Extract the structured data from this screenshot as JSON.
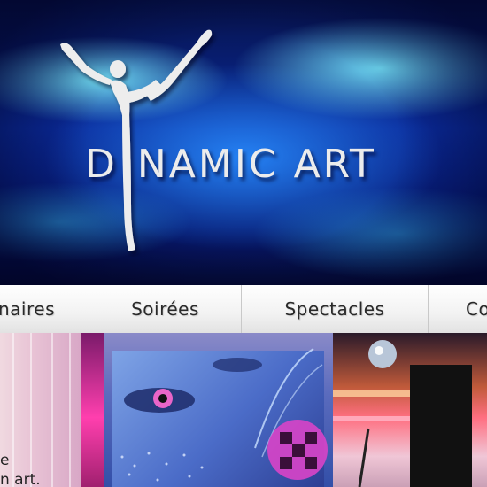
{
  "hero": {
    "logo_text_left": "D",
    "logo_text_right": "NAMIC",
    "logo_text_second": "ART",
    "logo_figure_icon": "dancer-figure-icon",
    "colors": {
      "glow": "#78ebff",
      "deep": "#0a2a9a",
      "text": "#ececec"
    }
  },
  "nav": {
    "items": [
      {
        "label": "naires"
      },
      {
        "label": "Soirées"
      },
      {
        "label": "Spectacles"
      },
      {
        "label": "Co"
      }
    ]
  },
  "banner": {
    "lines": [
      "e",
      "n art."
    ]
  }
}
